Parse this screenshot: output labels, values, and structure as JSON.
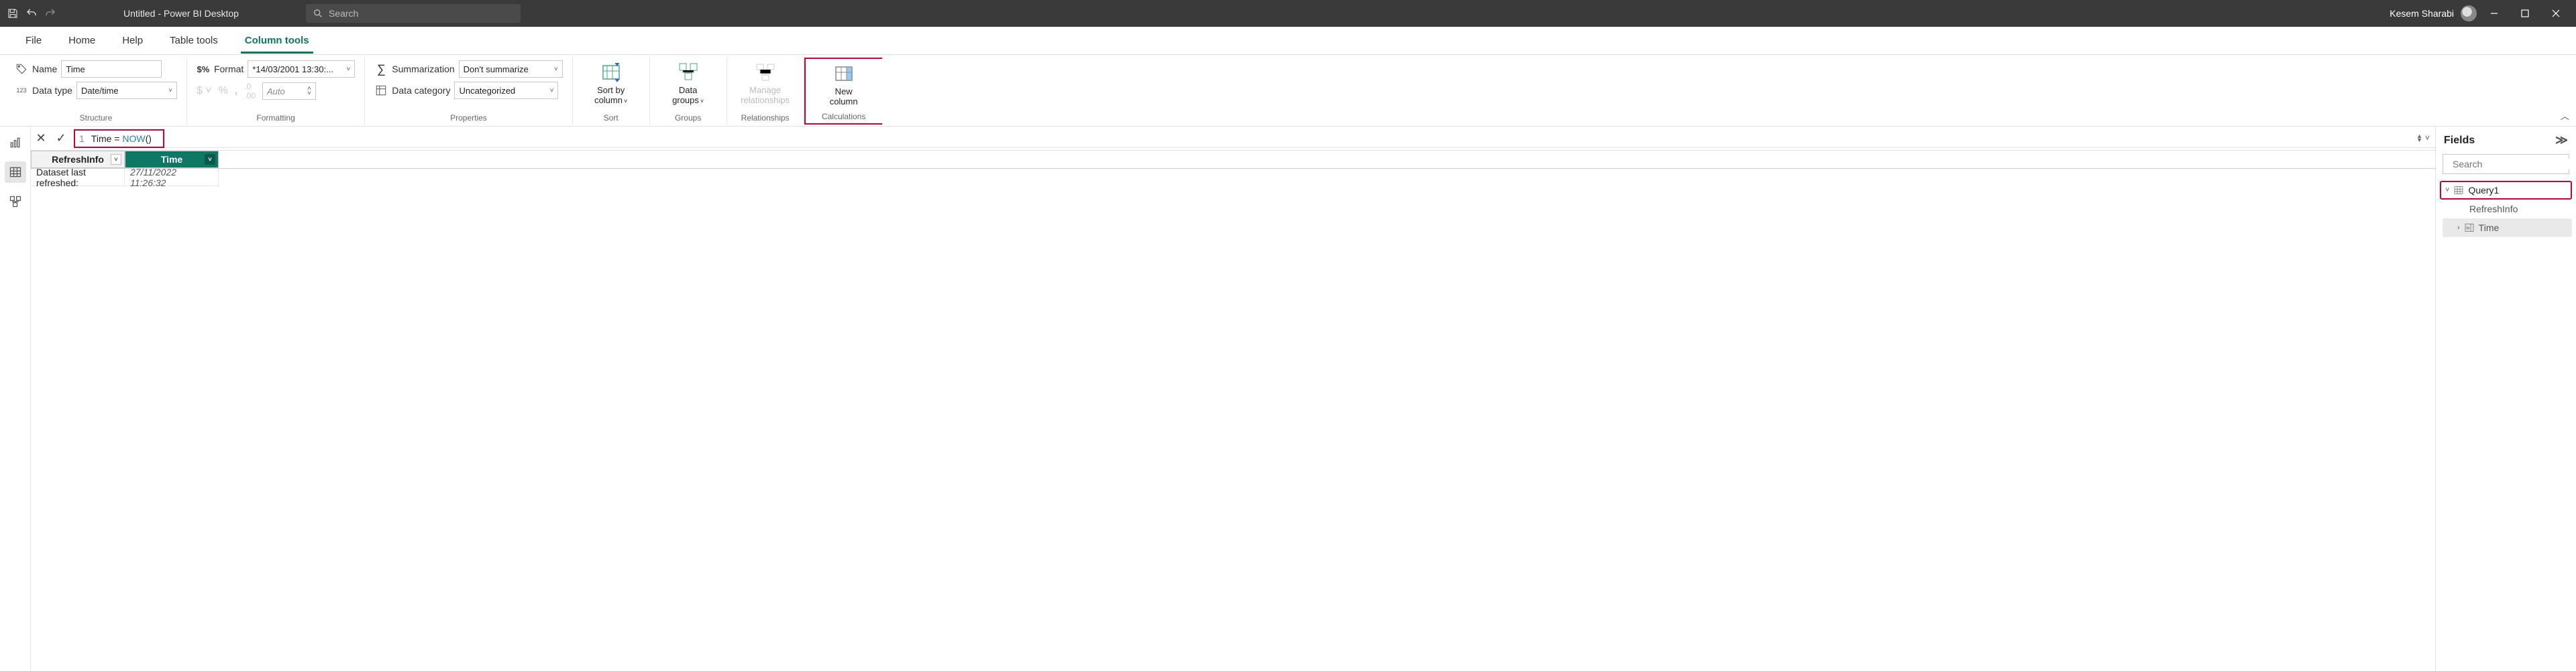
{
  "titlebar": {
    "title": "Untitled - Power BI Desktop",
    "search_placeholder": "Search",
    "username": "Kesem Sharabi"
  },
  "tabs": {
    "file": "File",
    "home": "Home",
    "help": "Help",
    "table_tools": "Table tools",
    "column_tools": "Column tools"
  },
  "ribbon": {
    "structure": {
      "name_label": "Name",
      "name_value": "Time",
      "datatype_label": "Data type",
      "datatype_value": "Date/time",
      "group_label": "Structure"
    },
    "formatting": {
      "format_label": "Format",
      "format_value": "*14/03/2001 13:30:...",
      "auto_label": "Auto",
      "group_label": "Formatting"
    },
    "properties": {
      "summarization_label": "Summarization",
      "summarization_value": "Don't summarize",
      "category_label": "Data category",
      "category_value": "Uncategorized",
      "group_label": "Properties"
    },
    "sort": {
      "button1": "Sort by",
      "button2": "column",
      "group_label": "Sort"
    },
    "groups": {
      "button1": "Data",
      "button2": "groups",
      "group_label": "Groups"
    },
    "relationships": {
      "button1": "Manage",
      "button2": "relationships",
      "group_label": "Relationships"
    },
    "calculations": {
      "button1": "New",
      "button2": "column",
      "group_label": "Calculations"
    }
  },
  "formula": {
    "line": "1",
    "prefix": "Time = ",
    "func": "NOW",
    "suffix": "()"
  },
  "grid": {
    "col_a": "RefreshInfo",
    "col_b": "Time",
    "row1_a": "Dataset last refreshed:",
    "row1_b": "27/11/2022 11:26:32"
  },
  "fields": {
    "title": "Fields",
    "search_placeholder": "Search",
    "table": "Query1",
    "field1": "RefreshInfo",
    "field2": "Time"
  }
}
